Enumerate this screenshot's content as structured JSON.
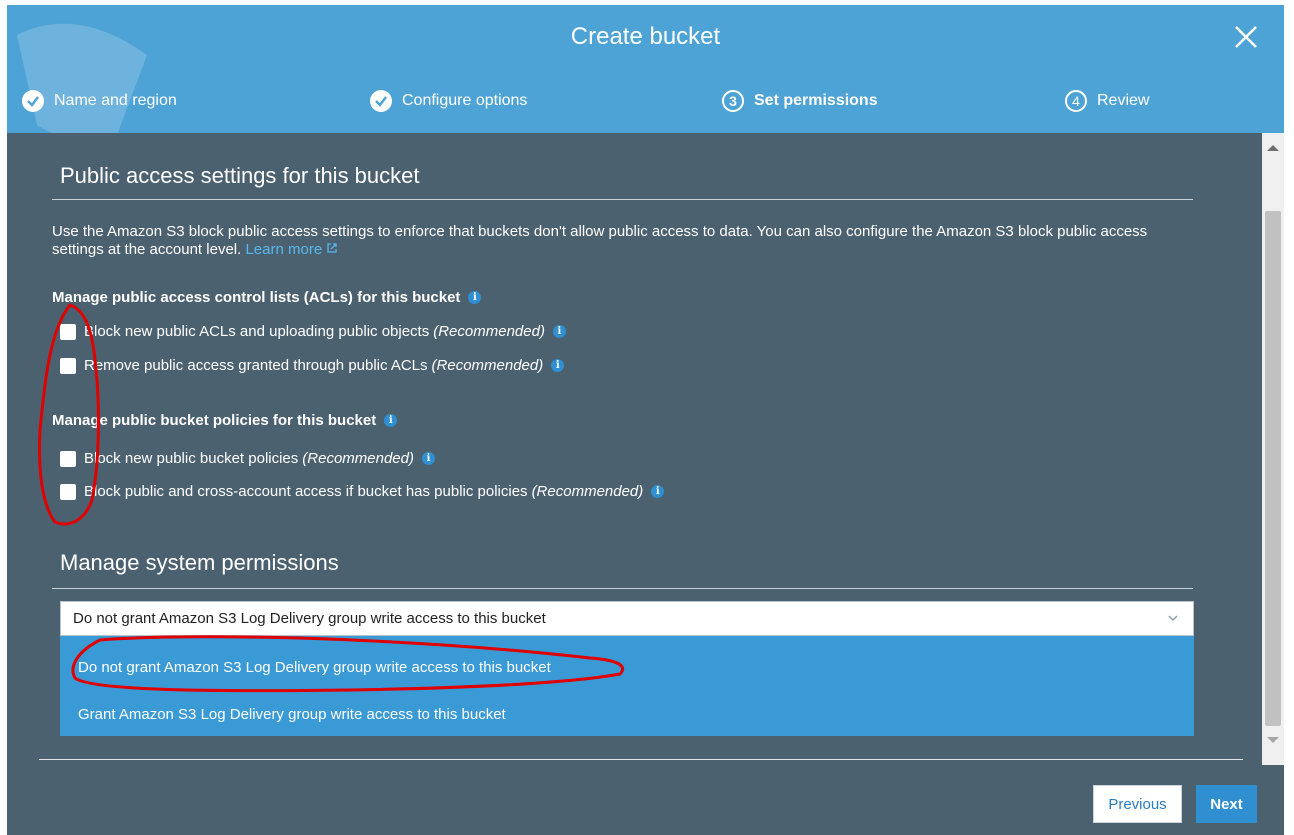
{
  "dialog": {
    "title": "Create bucket",
    "steps": [
      {
        "label": "Name and region",
        "state": "done"
      },
      {
        "label": "Configure options",
        "state": "done"
      },
      {
        "label": "Set permissions",
        "number": "3",
        "state": "current"
      },
      {
        "label": "Review",
        "number": "4",
        "state": "upcoming"
      }
    ]
  },
  "public_access": {
    "title": "Public access settings for this bucket",
    "description": "Use the Amazon S3 block public access settings to enforce that buckets don't allow public access to data. You can also configure the Amazon S3 block public access settings at the account level.",
    "learn_more": "Learn more",
    "acl_heading": "Manage public access control lists (ACLs) for this bucket",
    "acl_options": [
      {
        "label": "Block new public ACLs and uploading public objects",
        "note": "(Recommended)",
        "checked": false
      },
      {
        "label": "Remove public access granted through public ACLs",
        "note": "(Recommended)",
        "checked": false
      }
    ],
    "policy_heading": "Manage public bucket policies for this bucket",
    "policy_options": [
      {
        "label": "Block new public bucket policies",
        "note": "(Recommended)",
        "checked": false
      },
      {
        "label": "Block public and cross-account access if bucket has public policies",
        "note": "(Recommended)",
        "checked": false
      }
    ]
  },
  "system_permissions": {
    "title": "Manage system permissions",
    "selected": "Do not grant Amazon S3 Log Delivery group write access to this bucket",
    "options": [
      "Do not grant Amazon S3 Log Delivery group write access to this bucket",
      "Grant Amazon S3 Log Delivery group write access to this bucket"
    ]
  },
  "footer": {
    "previous": "Previous",
    "next": "Next"
  },
  "colors": {
    "header": "#4ea3d6",
    "body": "#4b6170",
    "accent": "#2f8fd1",
    "annotation": "#e00000"
  },
  "icons": [
    "close-icon",
    "check-icon",
    "external-link-icon",
    "info-icon",
    "chevron-down-icon"
  ]
}
